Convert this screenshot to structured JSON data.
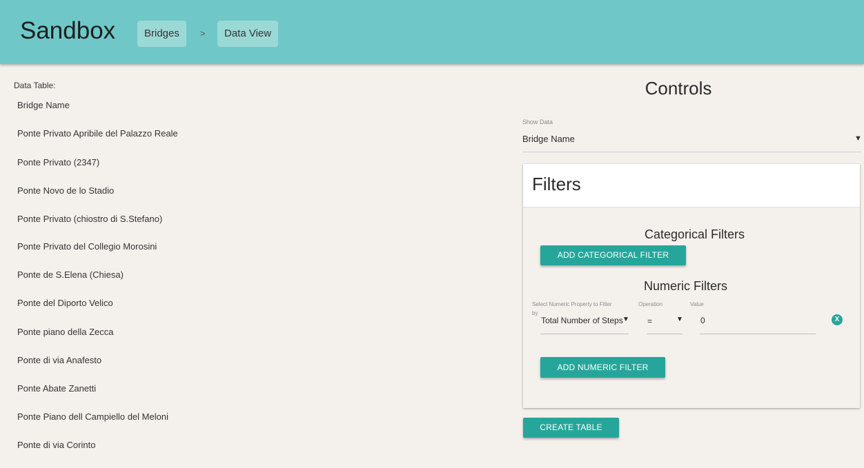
{
  "header": {
    "brand": "Sandbox",
    "breadcrumb": [
      "Bridges",
      ">",
      "Data View"
    ]
  },
  "table": {
    "label": "Data Table:",
    "column": "Bridge Name",
    "rows": [
      "Ponte Privato Apribile del Palazzo Reale",
      "Ponte Privato (2347)",
      "Ponte Novo de lo Stadio",
      "Ponte Privato (chiostro di S.Stefano)",
      "Ponte Privato del Collegio Morosini",
      "Ponte de S.Elena (Chiesa)",
      "Ponte del Diporto Velico",
      "Ponte piano della Zecca",
      "Ponte di via Anafesto",
      "Ponte Abate Zanetti",
      "Ponte Piano dell Campiello del Meloni",
      "Ponte di via Corinto"
    ]
  },
  "controls": {
    "title": "Controls",
    "show_data": {
      "label": "Show Data",
      "value": "Bridge Name"
    },
    "filters": {
      "title": "Filters",
      "categorical_title": "Categorical Filters",
      "add_categorical": "ADD CATEGORICAL FILTER",
      "numeric_title": "Numeric Filters",
      "numeric_row": {
        "property_label": "Select Numeric Property to Filter",
        "property_label_cont": "by",
        "property_value": "Total Number of Steps",
        "operation_label": "Operation",
        "operation_value": "=",
        "value_label": "Value",
        "value": "0"
      },
      "add_numeric": "ADD NUMERIC FILTER"
    },
    "create_table": "CREATE TABLE"
  },
  "icons": {
    "dropdown": "▼",
    "remove": "X"
  },
  "colors": {
    "header_bg": "#6fc8c7",
    "crumb_bg": "#9bd9d7",
    "accent": "#26a69a",
    "page_bg": "#f4f1ed"
  }
}
